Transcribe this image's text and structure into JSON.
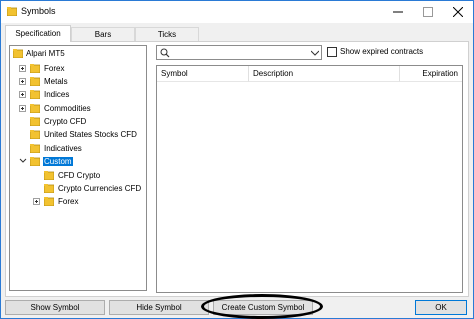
{
  "window": {
    "title": "Symbols"
  },
  "tabs": [
    {
      "label": "Specification",
      "active": true
    },
    {
      "label": "Bars",
      "active": false
    },
    {
      "label": "Ticks",
      "active": false
    }
  ],
  "tree": {
    "root": "Alpari MT5",
    "items": [
      {
        "label": "Forex",
        "expander": "plus"
      },
      {
        "label": "Metals",
        "expander": "plus"
      },
      {
        "label": "Indices",
        "expander": "plus"
      },
      {
        "label": "Commodities",
        "expander": "plus"
      },
      {
        "label": "Crypto CFD",
        "expander": "none"
      },
      {
        "label": "United States Stocks CFD",
        "expander": "none"
      },
      {
        "label": "Indicatives",
        "expander": "none"
      },
      {
        "label": "Custom",
        "expander": "expanded",
        "selected": true
      },
      {
        "label": "CFD Crypto",
        "expander": "none",
        "child": true
      },
      {
        "label": "Crypto Currencies CFD",
        "expander": "none",
        "child": true
      },
      {
        "label": "Forex",
        "expander": "plus",
        "child": true
      }
    ]
  },
  "search": {
    "value": ""
  },
  "show_expired": {
    "label": "Show expired contracts",
    "checked": false
  },
  "table": {
    "columns": [
      "Symbol",
      "Description",
      "Expiration"
    ]
  },
  "buttons": {
    "show_symbol": "Show Symbol",
    "hide_symbol": "Hide Symbol",
    "create_custom_symbol": "Create Custom Symbol",
    "ok": "OK"
  },
  "colors": {
    "accent": "#0078d7",
    "folder": "#f2c230",
    "highlight_ellipse": "#000000"
  }
}
